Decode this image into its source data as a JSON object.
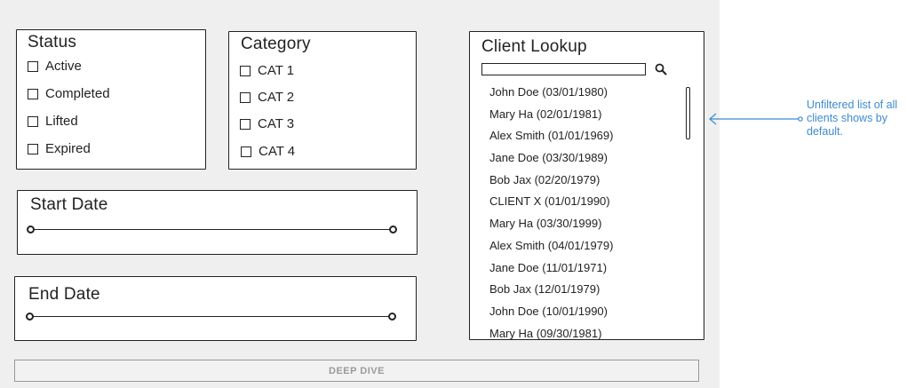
{
  "status": {
    "title": "Status",
    "options": [
      "Active",
      "Completed",
      "Lifted",
      "Expired"
    ]
  },
  "category": {
    "title": "Category",
    "options": [
      "CAT 1",
      "CAT 2",
      "CAT 3",
      "CAT 4"
    ]
  },
  "start_date": {
    "title": "Start Date"
  },
  "end_date": {
    "title": "End Date"
  },
  "client_lookup": {
    "title": "Client Lookup",
    "search_value": "",
    "clients": [
      "John Doe (03/01/1980)",
      "Mary Ha (02/01/1981)",
      "Alex Smith (01/01/1969)",
      "Jane Doe (03/30/1989)",
      "Bob Jax (02/20/1979)",
      "CLIENT X (01/01/1990)",
      "Mary Ha (03/30/1999)",
      "Alex Smith (04/01/1979)",
      "Jane Doe (11/01/1971)",
      "Bob Jax (12/01/1979)",
      "John Doe (10/01/1990)",
      "Mary Ha (09/30/1981)"
    ]
  },
  "deep_dive_label": "DEEP DIVE",
  "annotation": {
    "text": "Unfiltered list of all clients shows by default.",
    "color": "#3f8ad0"
  },
  "icons": {
    "search": "search-icon",
    "arrow": "arrow-left-icon"
  }
}
